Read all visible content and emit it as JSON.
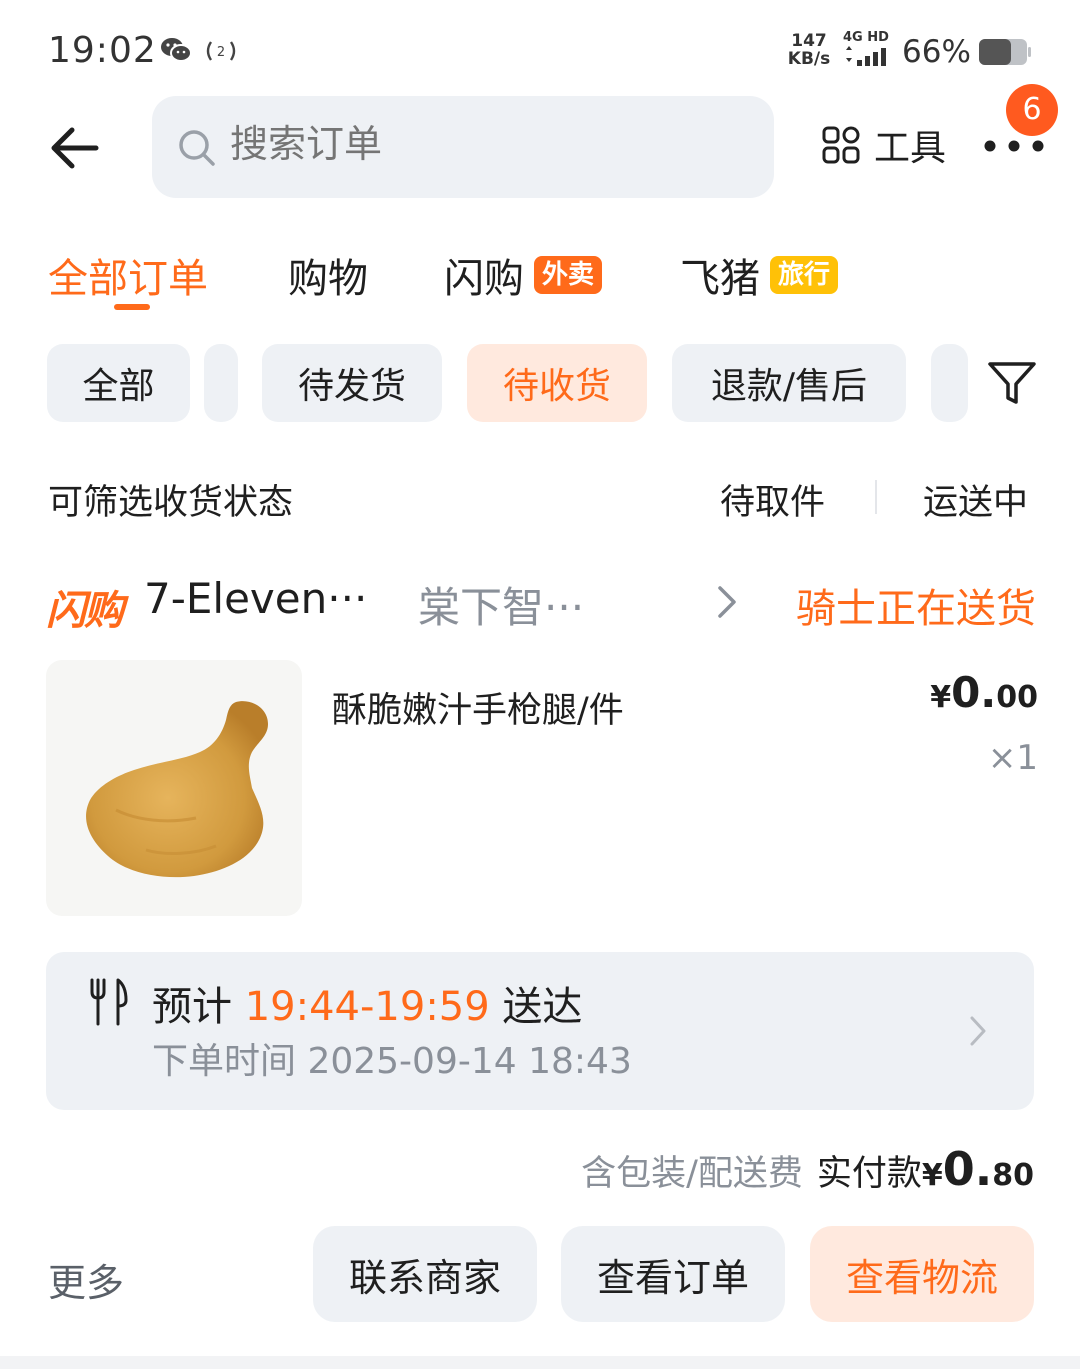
{
  "status_bar": {
    "time": "19:02",
    "speed_value": "147",
    "speed_unit": "KB/s",
    "network": "4G HD",
    "battery_percent": "66%"
  },
  "header": {
    "search_placeholder": "搜索订单",
    "tools_label": "工具",
    "notification_count": "6"
  },
  "main_tabs": [
    {
      "label": "全部订单",
      "active": true
    },
    {
      "label": "购物"
    },
    {
      "label": "闪购",
      "tag": "外卖"
    },
    {
      "label": "飞猪",
      "tag": "旅行"
    }
  ],
  "filter_chips": [
    {
      "label": "全部"
    },
    {
      "label": "待发货"
    },
    {
      "label": "待收货",
      "active": true
    },
    {
      "label": "退款/售后"
    }
  ],
  "sub_filter": {
    "label": "可筛选收货状态",
    "options": [
      "待取件",
      "运送中"
    ]
  },
  "order": {
    "platform_logo": "闪购",
    "shop_name": "7-Eleven···",
    "shop_branch": "棠下智···",
    "status": "骑士正在送货",
    "product_name": "酥脆嫩汁手枪腿/件",
    "price_symbol": "¥",
    "price_int": "0.",
    "price_dec": "00",
    "quantity": "×1",
    "eta_prefix": "预计",
    "eta_time": "19:44-19:59",
    "eta_suffix": "送达",
    "order_time": "下单时间 2025-09-14 18:43",
    "total_note": "含包装/配送费",
    "total_label": "实付款",
    "total_symbol": "¥",
    "total_int": "0.",
    "total_dec": "80"
  },
  "actions": {
    "more": "更多",
    "contact_seller": "联系商家",
    "view_order": "查看订单",
    "view_logistics": "查看物流"
  },
  "colors": {
    "accent": "#ff6a1a",
    "chip_bg": "#eef1f5",
    "chip_active_bg": "#ffe9de",
    "tag_yellow": "#ffc107",
    "badge": "#ff5a1f"
  }
}
